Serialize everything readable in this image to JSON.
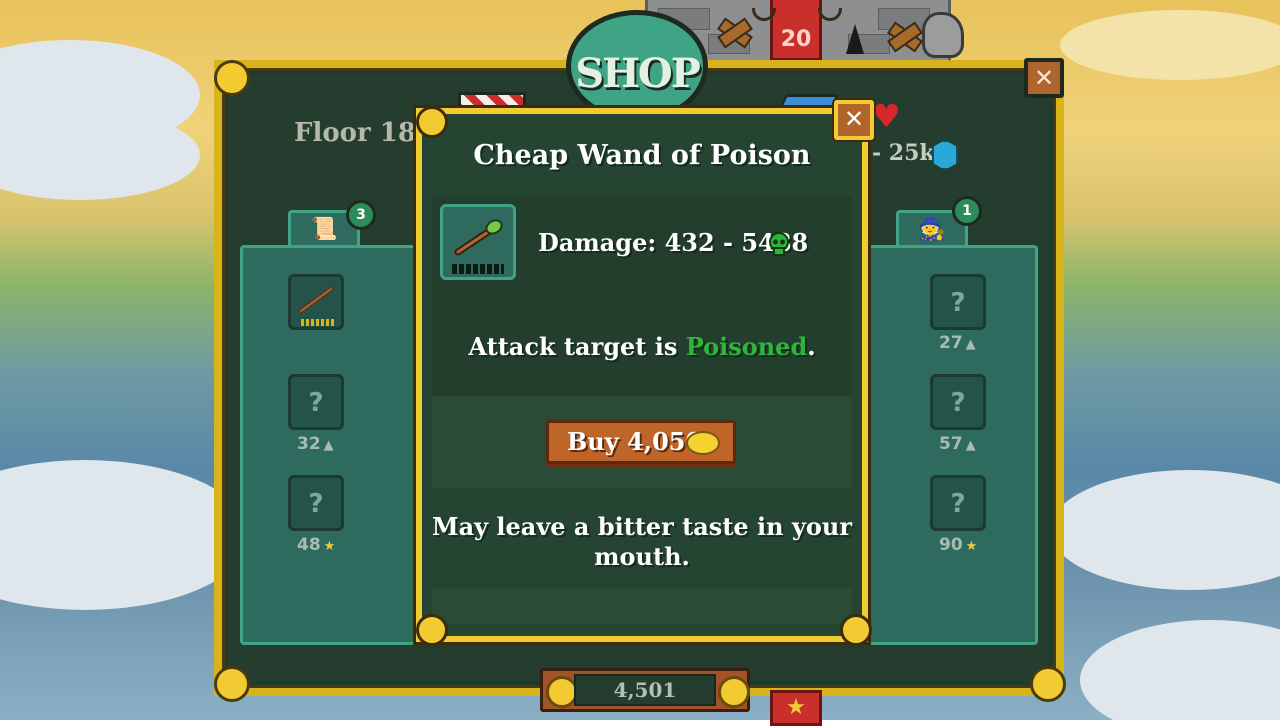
{
  "header": {
    "shop_title": "SHOP",
    "floor_label": "Floor 18",
    "tower_level": "20",
    "hp_text": "- 25k"
  },
  "left_panel": {
    "tab_badge": "3",
    "slots": [
      {
        "label": "",
        "price": ""
      },
      {
        "label": "?",
        "price": "32"
      },
      {
        "label": "?",
        "price": "48"
      }
    ]
  },
  "right_panel": {
    "tab_badge": "1",
    "slots": [
      {
        "label": "?",
        "price": "27"
      },
      {
        "label": "?",
        "price": "57"
      },
      {
        "label": "?",
        "price": "90"
      }
    ]
  },
  "popup": {
    "title": "Cheap Wand of Poison",
    "damage": "Damage: 432 - 5488",
    "effect_prefix": "Attack target is ",
    "effect_keyword": "Poisoned",
    "effect_suffix": ".",
    "buy_label": "Buy 4,050",
    "flavor_text": "May leave a bitter taste in your mouth.",
    "close_glyph": "✕"
  },
  "footer": {
    "gold": "4,501"
  },
  "board_close_glyph": "✕",
  "colors": {
    "board_border": "#d8b41a",
    "panel": "#2e6b5e",
    "poison": "#2fb53c",
    "buy_button": "#c0652a"
  },
  "icons": {
    "left_tab": "scroll-icon",
    "right_tab": "hat-icon",
    "item": "wand-icon",
    "damage_type": "skull-icon",
    "currency": "coin-icon",
    "hp": "heart-icon",
    "gem": "gem-icon"
  }
}
